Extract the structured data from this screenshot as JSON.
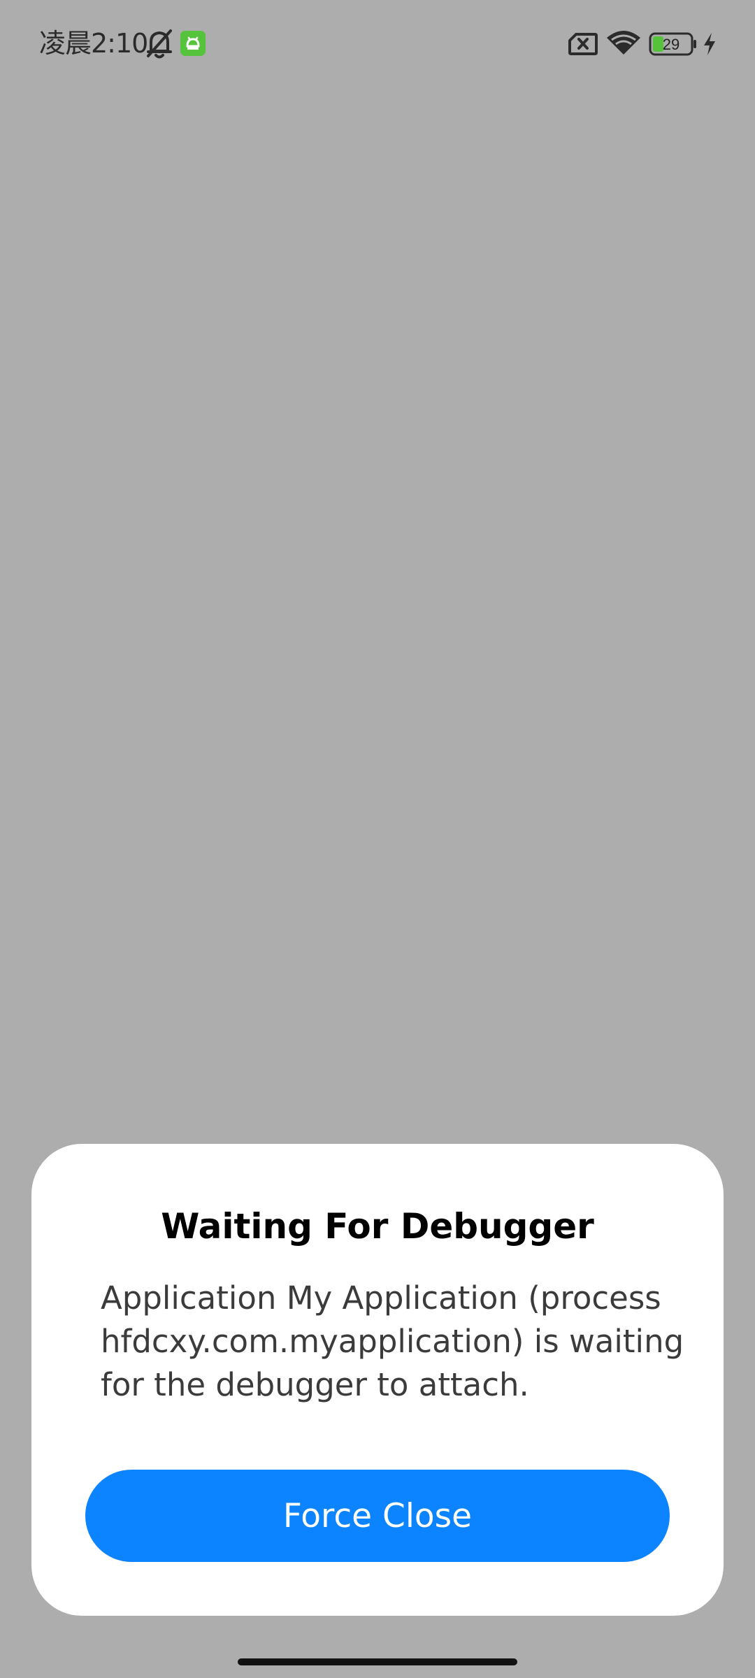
{
  "status_bar": {
    "time": "凌晨2:10",
    "battery_level": "29",
    "icons": [
      "bell-off-icon",
      "android-debug-icon",
      "sim-error-icon",
      "wifi-icon",
      "battery-icon",
      "charging-bolt-icon"
    ],
    "colors": {
      "battery_fill": "#55c33c",
      "debug_badge": "#55c33c"
    }
  },
  "dialog": {
    "title": "Waiting For Debugger",
    "message": "Application My Application (process hfdcxy.com.myapplication) is waiting for the debugger to attach.",
    "force_close_label": "Force Close",
    "button_color": "#0d84ff"
  },
  "colors": {
    "scrim": "#adadad",
    "dialog_background": "#ffffff"
  }
}
